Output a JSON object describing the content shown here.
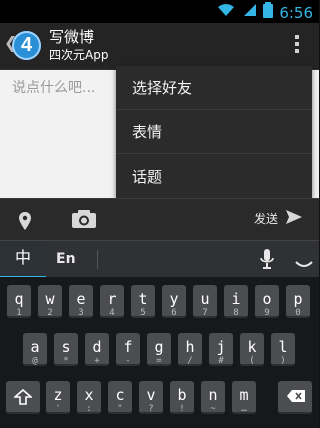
{
  "status_bar": {
    "time": "6:56"
  },
  "action_bar": {
    "back_caret": "❮",
    "app_icon_text": "4",
    "title": "写微博",
    "subtitle": "四次元App"
  },
  "compose": {
    "placeholder": "说点什么吧..."
  },
  "menu": {
    "items": [
      {
        "label": "选择好友"
      },
      {
        "label": "表情"
      },
      {
        "label": "话题"
      }
    ]
  },
  "toolbar": {
    "send_label": "发送"
  },
  "keyboard_top": {
    "mode_zh": "中",
    "mode_en": "En"
  },
  "keyboard": {
    "rows": [
      [
        {
          "main": "q",
          "sub": "1"
        },
        {
          "main": "w",
          "sub": "2"
        },
        {
          "main": "e",
          "sub": "3"
        },
        {
          "main": "r",
          "sub": "4"
        },
        {
          "main": "t",
          "sub": "5"
        },
        {
          "main": "y",
          "sub": "6"
        },
        {
          "main": "u",
          "sub": "7"
        },
        {
          "main": "i",
          "sub": "8"
        },
        {
          "main": "o",
          "sub": "9"
        },
        {
          "main": "p",
          "sub": "0"
        }
      ],
      [
        {
          "main": "a",
          "sub": "@"
        },
        {
          "main": "s",
          "sub": "*"
        },
        {
          "main": "d",
          "sub": "+"
        },
        {
          "main": "f",
          "sub": "-"
        },
        {
          "main": "g",
          "sub": "="
        },
        {
          "main": "h",
          "sub": "/"
        },
        {
          "main": "j",
          "sub": "#"
        },
        {
          "main": "k",
          "sub": "("
        },
        {
          "main": "l",
          "sub": ")"
        }
      ],
      [
        {
          "main": "z",
          "sub": "'"
        },
        {
          "main": "x",
          "sub": ":"
        },
        {
          "main": "c",
          "sub": "\""
        },
        {
          "main": "v",
          "sub": "?"
        },
        {
          "main": "b",
          "sub": "!"
        },
        {
          "main": "n",
          "sub": "~"
        },
        {
          "main": "m",
          "sub": "…"
        }
      ]
    ]
  }
}
